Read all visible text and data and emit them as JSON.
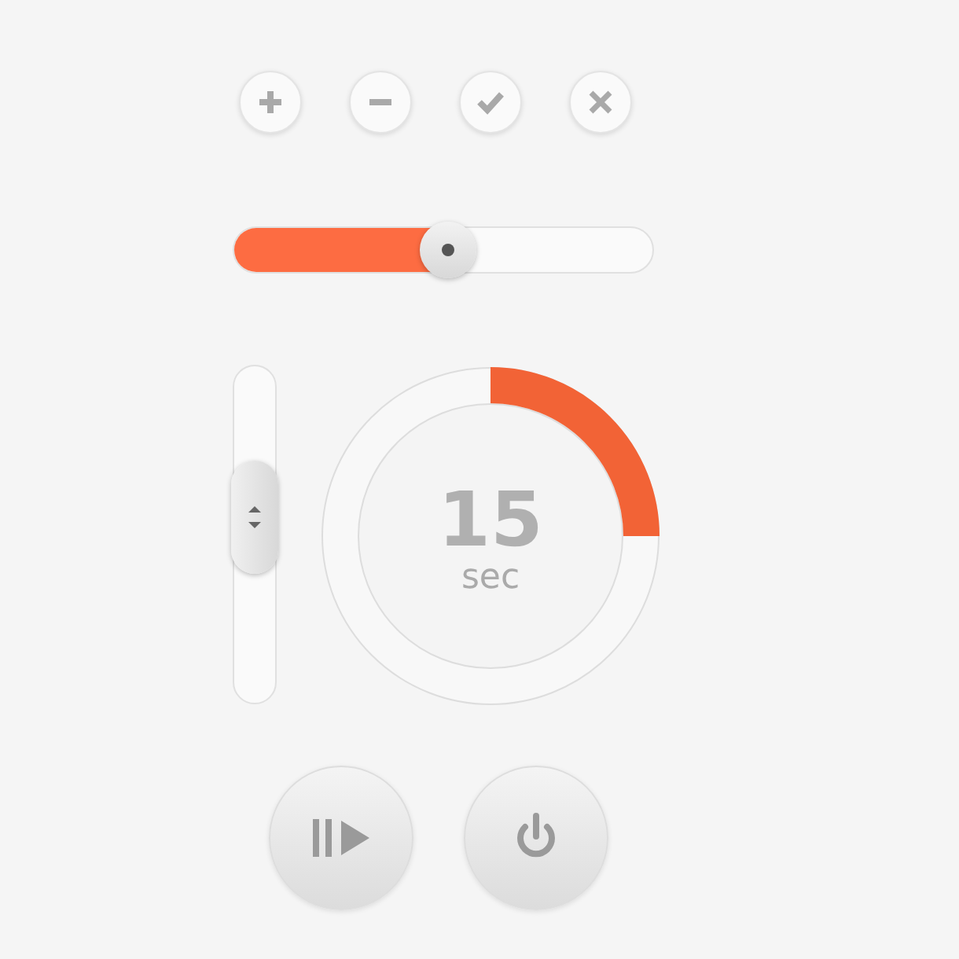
{
  "action_buttons": [
    {
      "kind": "plus"
    },
    {
      "kind": "minus"
    },
    {
      "kind": "check"
    },
    {
      "kind": "close"
    }
  ],
  "slider": {
    "level": 0.51
  },
  "vertical_slider": {
    "level": 0.55
  },
  "timer": {
    "value": "15",
    "unit": "sec",
    "level": 0.25
  },
  "media_buttons": [
    {
      "kind": "play-pause"
    },
    {
      "kind": "power"
    }
  ]
}
